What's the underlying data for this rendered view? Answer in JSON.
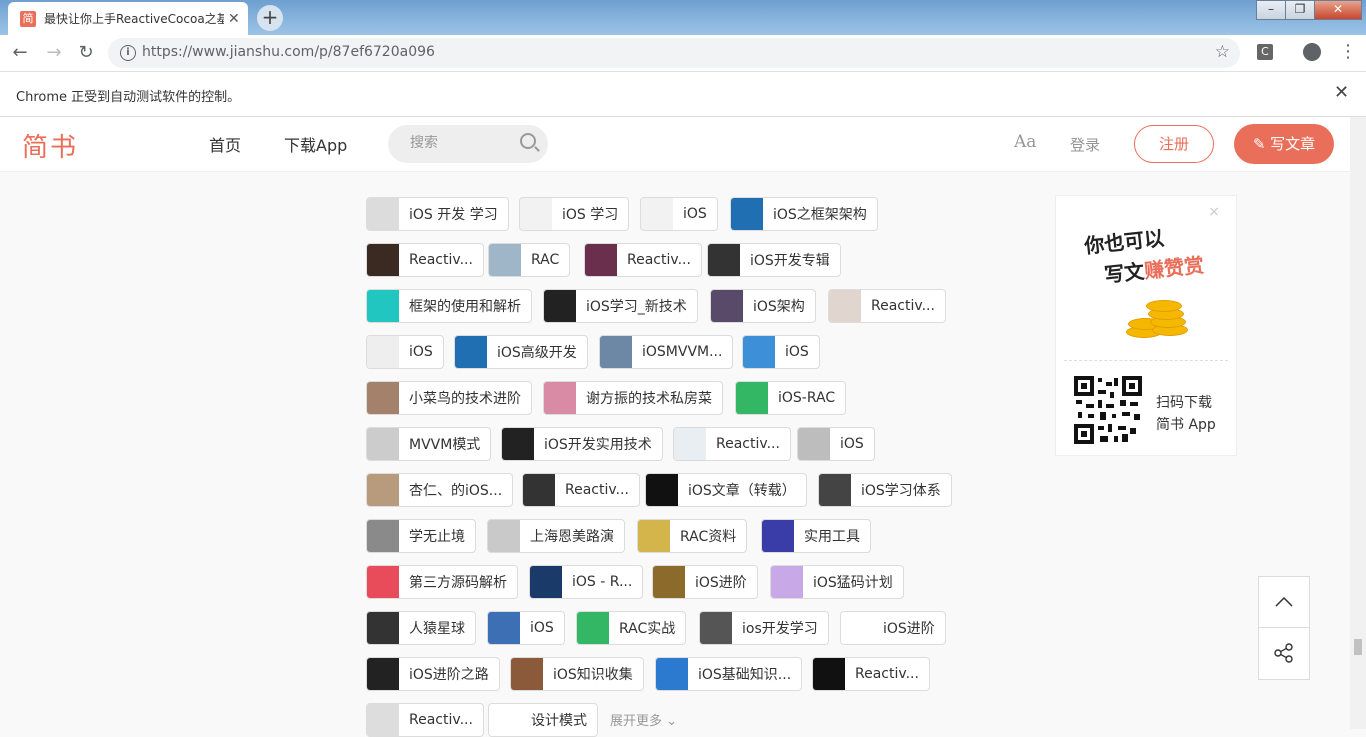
{
  "browser": {
    "tab_title": "最快让你上手ReactiveCocoa之基",
    "tab_favicon": "简",
    "url": "https://www.jianshu.com/p/87ef6720a096",
    "infobar_text": "Chrome 正受到自动测试软件的控制。",
    "ext_label": "C"
  },
  "site": {
    "logo": "简书",
    "nav_home": "首页",
    "nav_app": "下载App",
    "search_placeholder": "搜索",
    "aa": "Aa",
    "login": "登录",
    "register": "注册",
    "write": "写文章"
  },
  "collections": [
    {
      "name": "iOS 开发 学习",
      "color": "#dcdcdc"
    },
    {
      "name": "iOS 学习",
      "color": "#f2f2f2"
    },
    {
      "name": "iOS",
      "color": "#f2f2f2"
    },
    {
      "name": "iOS之框架架构",
      "color": "#1f6fb2"
    },
    {
      "name": "Reactiv...",
      "color": "#3a2a22"
    },
    {
      "name": "RAC",
      "color": "#9fb6c8"
    },
    {
      "name": "Reactiv...",
      "color": "#6a2f4d"
    },
    {
      "name": "iOS开发专辑",
      "color": "#333333"
    },
    {
      "name": "框架的使用和解析",
      "color": "#21c6c0"
    },
    {
      "name": "iOS学习_新技术",
      "color": "#222222"
    },
    {
      "name": "iOS架构",
      "color": "#5a4a6a"
    },
    {
      "name": "Reactiv...",
      "color": "#e0d6cf"
    },
    {
      "name": "iOS",
      "color": "#eeeeee"
    },
    {
      "name": "iOS高级开发",
      "color": "#1f6fb2"
    },
    {
      "name": "iOSMVVM...",
      "color": "#6d88a5"
    },
    {
      "name": "iOS",
      "color": "#3d8fd8"
    },
    {
      "name": "小菜鸟的技术进阶",
      "color": "#a3816a"
    },
    {
      "name": "谢方振的技术私房菜",
      "color": "#d98aa5"
    },
    {
      "name": "iOS-RAC",
      "color": "#34b765"
    },
    {
      "name": "MVVM模式",
      "color": "#cccccc"
    },
    {
      "name": "iOS开发实用技术",
      "color": "#222222"
    },
    {
      "name": "Reactiv...",
      "color": "#e9eef2"
    },
    {
      "name": "iOS",
      "color": "#bdbdbd"
    },
    {
      "name": "杏仁、的iOS...",
      "color": "#b89b7d"
    },
    {
      "name": "Reactiv...",
      "color": "#333333"
    },
    {
      "name": "iOS文章（转载）",
      "color": "#111111"
    },
    {
      "name": "iOS学习体系",
      "color": "#444444"
    },
    {
      "name": "学无止境",
      "color": "#8a8a8a"
    },
    {
      "name": "上海恩美路演",
      "color": "#c9c9c9"
    },
    {
      "name": "RAC资料",
      "color": "#d4b54c"
    },
    {
      "name": "实用工具",
      "color": "#3a3da8"
    },
    {
      "name": "第三方源码解析",
      "color": "#e84b5a"
    },
    {
      "name": "iOS - R...",
      "color": "#1a3a6a"
    },
    {
      "name": "iOS进阶",
      "color": "#8c6a2c"
    },
    {
      "name": "iOS猛码计划",
      "color": "#c9a8e8"
    },
    {
      "name": "人猿星球",
      "color": "#333333"
    },
    {
      "name": "iOS",
      "color": "#3c6fb4"
    },
    {
      "name": "RAC实战",
      "color": "#34b765"
    },
    {
      "name": "ios开发学习",
      "color": "#555555"
    },
    {
      "name": "iOS进阶",
      "color": "#ffffff"
    },
    {
      "name": "iOS进阶之路",
      "color": "#222222"
    },
    {
      "name": "iOS知识收集",
      "color": "#8a5a3a"
    },
    {
      "name": "iOS基础知识...",
      "color": "#2c7ad0"
    },
    {
      "name": "Reactiv...",
      "color": "#111111"
    },
    {
      "name": "Reactiv...",
      "color": "#dddddd"
    },
    {
      "name": "设计模式",
      "color": "#ffffff"
    }
  ],
  "expand_more": "展开更多",
  "ad": {
    "line1": "你也可以",
    "line2_prefix": "写文",
    "line2_highlight": "赚赞赏",
    "qr_line1": "扫码下载",
    "qr_line2": "简书 App",
    "close": "×"
  }
}
